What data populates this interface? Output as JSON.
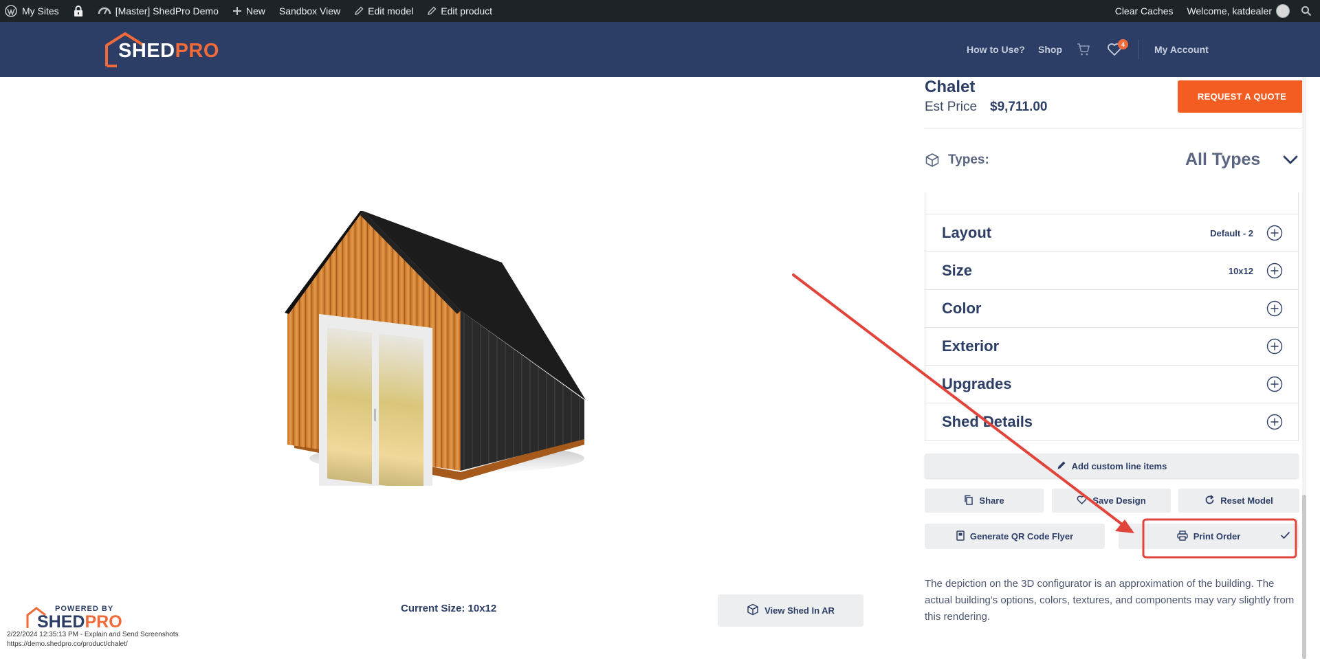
{
  "adminbar": {
    "my_sites": "My Sites",
    "site_name": "[Master] ShedPro Demo",
    "new": "New",
    "sandbox": "Sandbox View",
    "edit_model": "Edit model",
    "edit_product": "Edit product",
    "clear_caches": "Clear Caches",
    "welcome": "Welcome, katdealer"
  },
  "header": {
    "logo_shed": "SHED",
    "logo_pro": "PRO",
    "nav_how": "How to Use?",
    "nav_shop": "Shop",
    "wishlist_count": "4",
    "nav_account": "My Account"
  },
  "viewer": {
    "current_size": "Current Size: 10x12",
    "ar_button": "View Shed In AR",
    "powered_by": "POWERED BY",
    "powered_shed": "SHED",
    "powered_pro": "PRO",
    "capture_line1": "2/22/2024 12:35:13 PM - Explain and Send Screenshots",
    "capture_line2": "https://demo.shedpro.co/product/chalet/"
  },
  "product": {
    "name": "Chalet",
    "est_label": "Est Price",
    "price": "$9,711.00",
    "quote_button": "REQUEST A QUOTE",
    "types_label": "Types:",
    "types_value": "All Types"
  },
  "accordion": [
    {
      "label": "Layout",
      "value": "Default - 2"
    },
    {
      "label": "Size",
      "value": "10x12"
    },
    {
      "label": "Color",
      "value": ""
    },
    {
      "label": "Exterior",
      "value": ""
    },
    {
      "label": "Upgrades",
      "value": ""
    },
    {
      "label": "Shed Details",
      "value": ""
    }
  ],
  "actions": {
    "custom_items": "Add custom line items",
    "share": "Share",
    "save": "Save Design",
    "reset": "Reset Model",
    "qr": "Generate QR Code Flyer",
    "print": "Print Order"
  },
  "note": "The depiction on the 3D configurator is an approximation of the building. The actual building's options, colors, textures, and components may vary slightly from this rendering.",
  "colors": {
    "navy": "#2d3e66",
    "orange": "#f45d22",
    "annotation_red": "#e0443a"
  },
  "icons": [
    "wordpress-icon",
    "lock-icon",
    "dashboard-icon",
    "plus-icon",
    "pencil-icon",
    "search-icon",
    "cart-icon",
    "heart-icon",
    "cube-icon",
    "chevron-down-icon",
    "copy-icon",
    "refresh-icon",
    "qr-icon",
    "printer-icon",
    "check-icon"
  ]
}
